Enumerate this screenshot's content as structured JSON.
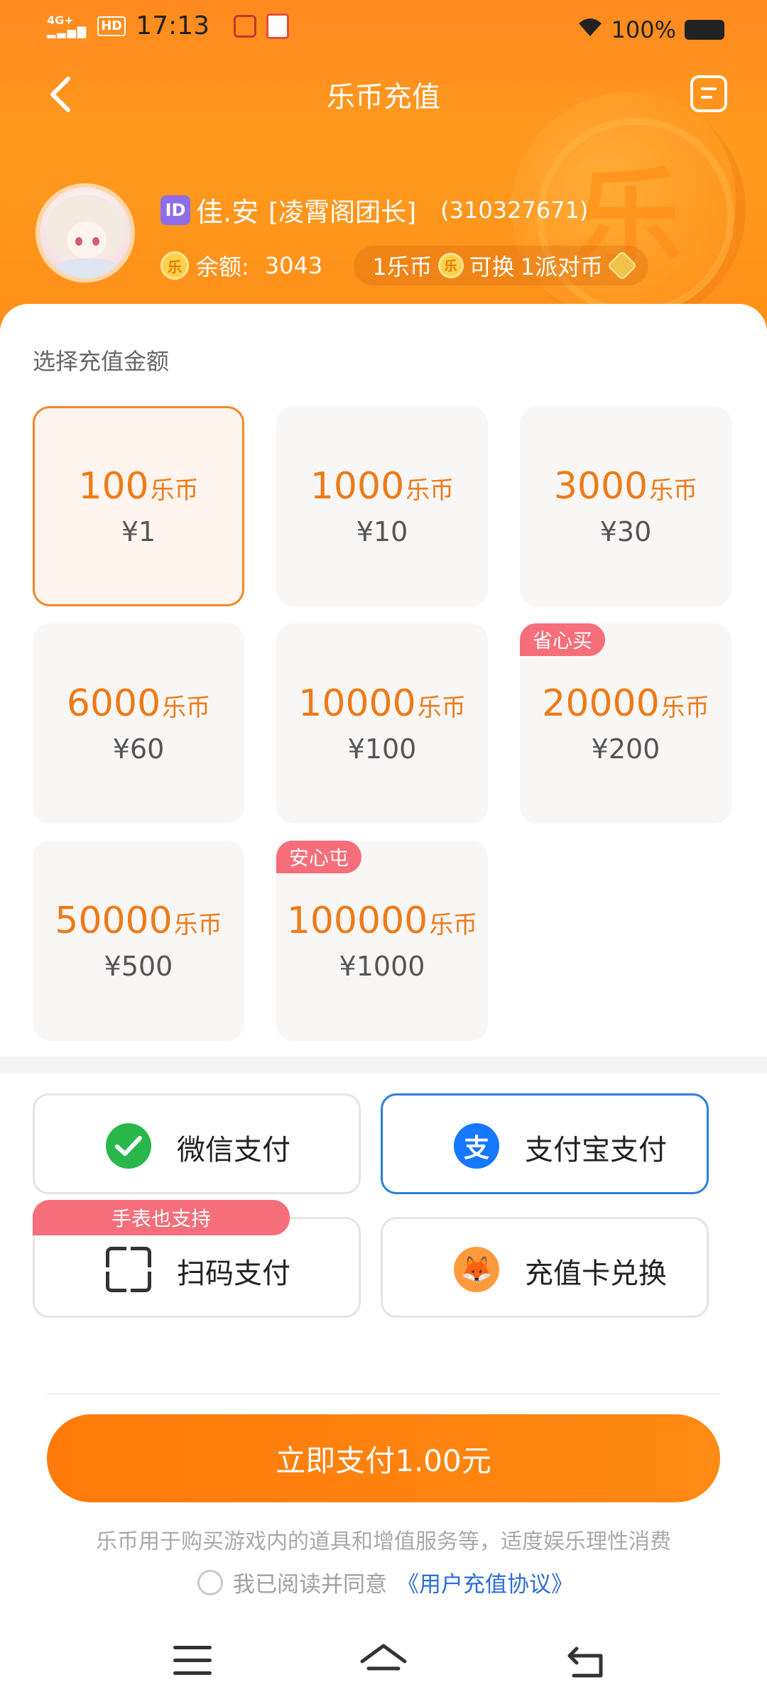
{
  "status_bar": {
    "network": "4G+",
    "hd": "HD",
    "time": "17:13",
    "battery": "100%"
  },
  "nav": {
    "title": "乐币充值",
    "back_icon": "chevron-left-icon",
    "menu_icon": "document-list-icon"
  },
  "profile": {
    "id_badge": "ID",
    "name": "佳.安",
    "title": "[凌霄阁团长]",
    "user_id": "(310327671)",
    "balance_label": "余额:",
    "balance_value": "3043",
    "rate_left": "1乐币",
    "rate_mid": "可换",
    "rate_right": "1派对币"
  },
  "recharge": {
    "section_label": "选择充值金额",
    "unit": "乐币",
    "options": [
      {
        "amount": "100",
        "price": "¥1",
        "tag": "",
        "selected": true
      },
      {
        "amount": "1000",
        "price": "¥10",
        "tag": "",
        "selected": false
      },
      {
        "amount": "3000",
        "price": "¥30",
        "tag": "",
        "selected": false
      },
      {
        "amount": "6000",
        "price": "¥60",
        "tag": "",
        "selected": false
      },
      {
        "amount": "10000",
        "price": "¥100",
        "tag": "",
        "selected": false
      },
      {
        "amount": "20000",
        "price": "¥200",
        "tag": "省心买",
        "selected": false
      },
      {
        "amount": "50000",
        "price": "¥500",
        "tag": "",
        "selected": false
      },
      {
        "amount": "100000",
        "price": "¥1000",
        "tag": "安心屯",
        "selected": false
      }
    ]
  },
  "payment": {
    "wechat": "微信支付",
    "alipay": "支付宝支付",
    "scan": "扫码支付",
    "card": "充值卡兑换",
    "watch_tag": "手表也支持",
    "selected": "alipay"
  },
  "footer": {
    "pay_button": "立即支付1.00元",
    "disclaimer": "乐币用于购买游戏内的道具和增值服务等，适度娱乐理性消费",
    "agree_text": "我已阅读并同意",
    "agree_link": "《用户充值协议》"
  },
  "colors": {
    "brand_orange": "#ff8a14",
    "price_orange": "#ee7a16",
    "tag_pink": "#f56e79",
    "alipay_blue": "#1677ff",
    "wechat_green": "#29b74a"
  }
}
